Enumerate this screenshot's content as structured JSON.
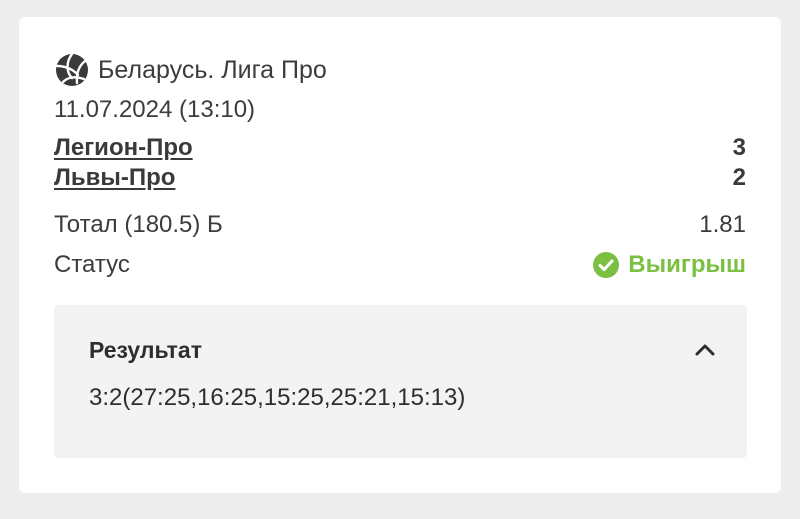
{
  "colors": {
    "background": "#ededed",
    "card": "#ffffff",
    "win_green": "#7bc043",
    "result_box": "#f3f3f3",
    "text": "#3a3a3a"
  },
  "match": {
    "league_icon": "volleyball-icon",
    "league": "Беларусь. Лига Про",
    "date": "11.07.2024 (13:10)",
    "teams": [
      {
        "name": "Легион-Про",
        "score": "3"
      },
      {
        "name": "Львы-Про",
        "score": "2"
      }
    ]
  },
  "bet": {
    "selection": "Тотал (180.5) Б",
    "odds": "1.81"
  },
  "status": {
    "label": "Статус",
    "icon": "check-circle-icon",
    "value": "Выигрыш"
  },
  "result": {
    "title": "Результат",
    "toggle_icon": "chevron-up-icon",
    "value": "3:2(27:25,16:25,15:25,25:21,15:13)"
  }
}
